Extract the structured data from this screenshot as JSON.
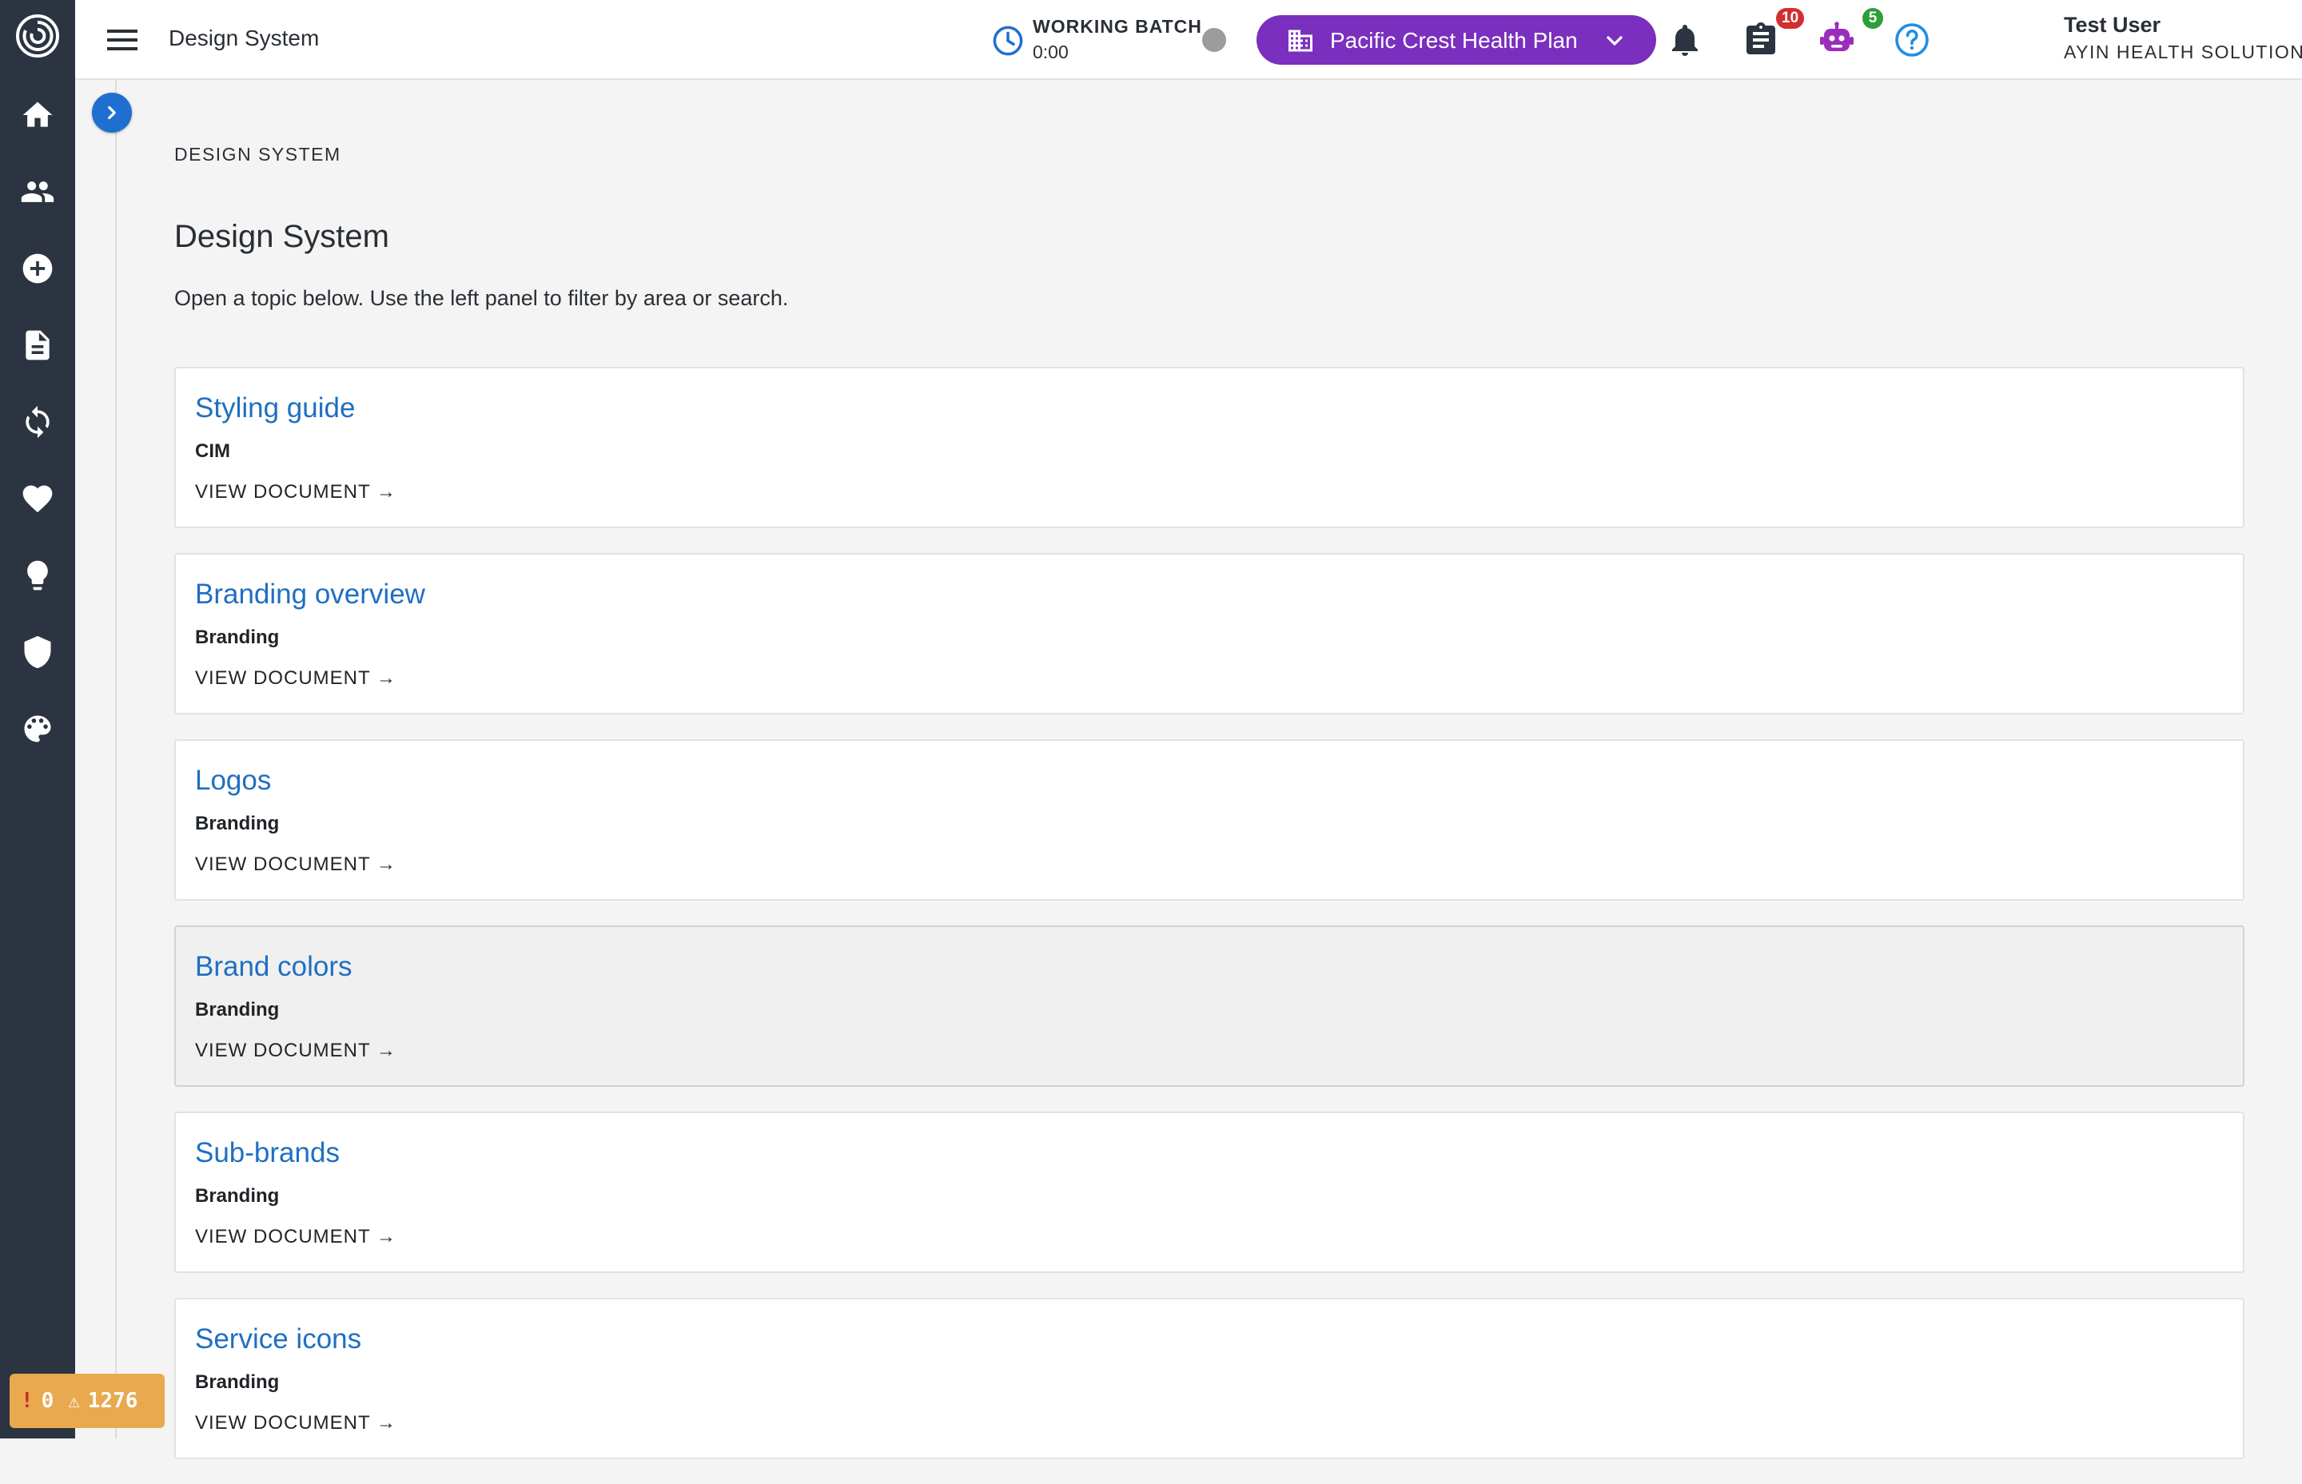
{
  "header": {
    "app_title": "Design System",
    "batch": {
      "label": "WORKING BATCH",
      "time": "0:00"
    },
    "plan": {
      "label": "Pacific Crest Health Plan"
    },
    "notifications_count": "10",
    "tasks_count": "5",
    "user": {
      "name": "Test User",
      "org": "AYIN HEALTH SOLUTIONS"
    }
  },
  "colors": {
    "rail": "#2b3440",
    "accent_purple": "#7b2fbe",
    "link_blue": "#1f6fc2",
    "badge_red": "#d32f2f",
    "badge_green": "#2e9e3a",
    "debug_orange": "#e8a94f"
  },
  "rail_icons": [
    "home-icon",
    "people-icon",
    "add-circle-icon",
    "document-icon",
    "sync-icon",
    "heart-icon",
    "lightbulb-icon",
    "shield-icon",
    "palette-icon"
  ],
  "main": {
    "breadcrumb": "DESIGN SYSTEM",
    "title": "Design System",
    "description": "Open a topic below. Use the left panel to filter by area or search.",
    "cards": [
      {
        "title": "Styling guide",
        "category": "CIM",
        "link": "VIEW DOCUMENT →"
      },
      {
        "title": "Branding overview",
        "category": "Branding",
        "link": "VIEW DOCUMENT →"
      },
      {
        "title": "Logos",
        "category": "Branding",
        "link": "VIEW DOCUMENT →"
      },
      {
        "title": "Brand colors",
        "category": "Branding",
        "link": "VIEW DOCUMENT →"
      },
      {
        "title": "Sub-brands",
        "category": "Branding",
        "link": "VIEW DOCUMENT →"
      },
      {
        "title": "Service icons",
        "category": "Branding",
        "link": "VIEW DOCUMENT →"
      }
    ]
  },
  "debug": {
    "errors": "0",
    "warnings": "1276"
  }
}
